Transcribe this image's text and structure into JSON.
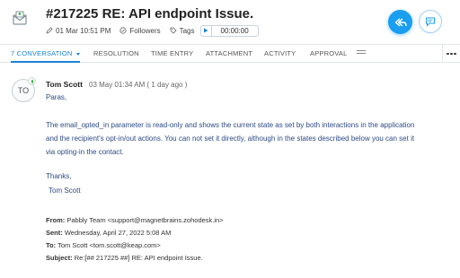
{
  "ticket": {
    "title": "#217225  RE: API endpoint Issue.",
    "date": "01 Mar 10:51 PM",
    "followers_label": "Followers",
    "tags_label": "Tags",
    "timer": "00:00:00"
  },
  "tabs": [
    {
      "label": "7 CONVERSATION",
      "active": true
    },
    {
      "label": "RESOLUTION"
    },
    {
      "label": "TIME ENTRY"
    },
    {
      "label": "ATTACHMENT"
    },
    {
      "label": "ACTIVITY"
    },
    {
      "label": "APPROVAL"
    }
  ],
  "message": {
    "avatar_initials": "TO",
    "sender": "Tom Scott",
    "time": "03 May 01:34 AM ( 1 day ago )",
    "greeting": "Paras,",
    "para_line1": "The email_opted_in parameter is read-only and shows the current state as set by both interactions in the application",
    "para_line2": "and the recipient's opt-in/out actions.  You can not set it directly, although in the states described below you can set it",
    "para_line3": "via opting-in the contact.",
    "signoff": "Thanks,",
    "signature": "Tom Scott"
  },
  "quoted": {
    "from_label": "From:",
    "from": "Pabbly Team <support@magnetbrains.zohodesk.in>",
    "sent_label": "Sent:",
    "sent": "Wednesday, April 27, 2022 5:08 AM",
    "to_label": "To:",
    "to": "Tom Scott <tom.scott@keap.com>",
    "subject_label": "Subject:",
    "subject": "Re:[## 217225 ##] RE: API endpoint Issue."
  },
  "colors": {
    "accent": "#1a9ef2",
    "tab_active": "#1a84d6",
    "body_text": "#2d4a86"
  }
}
